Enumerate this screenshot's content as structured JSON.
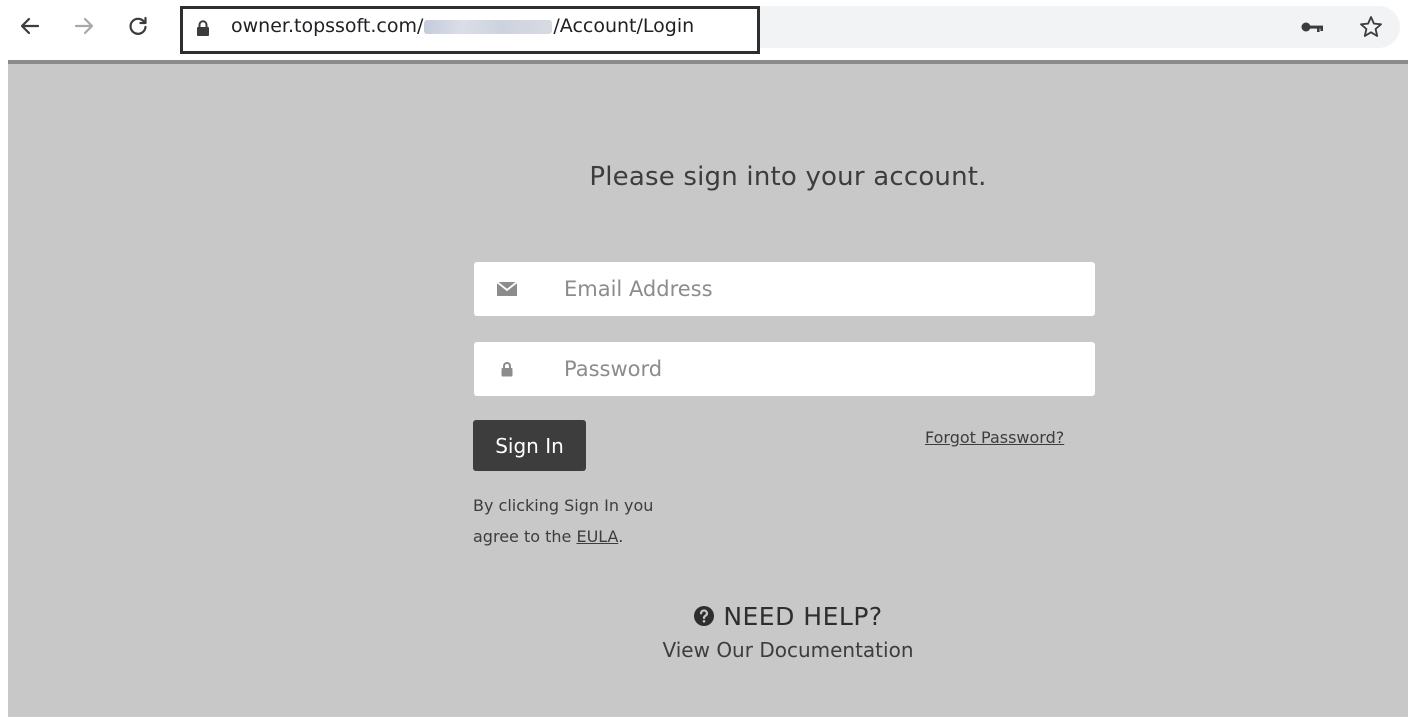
{
  "browser": {
    "url_prefix": "owner.topssoft.com/",
    "url_suffix": "/Account/Login",
    "icons": {
      "back": "arrow-left-icon",
      "forward": "arrow-right-icon",
      "reload": "reload-icon",
      "lock": "lock-icon",
      "key": "key-icon",
      "bookmark": "star-icon"
    }
  },
  "login": {
    "heading": "Please sign into your account.",
    "email_placeholder": "Email Address",
    "password_placeholder": "Password",
    "signin_label": "Sign In",
    "forgot_label": "Forgot Password?",
    "legal_line1": "By clicking Sign In you",
    "legal_line2_prefix": "agree to the ",
    "eula_label": "EULA",
    "legal_line2_suffix": "."
  },
  "help": {
    "title": "NEED HELP?",
    "link_label": "View Our Documentation"
  },
  "colors": {
    "page_background": "#c8c8c8",
    "button_background": "#3d3d3d",
    "text": "#3d3d3d"
  }
}
